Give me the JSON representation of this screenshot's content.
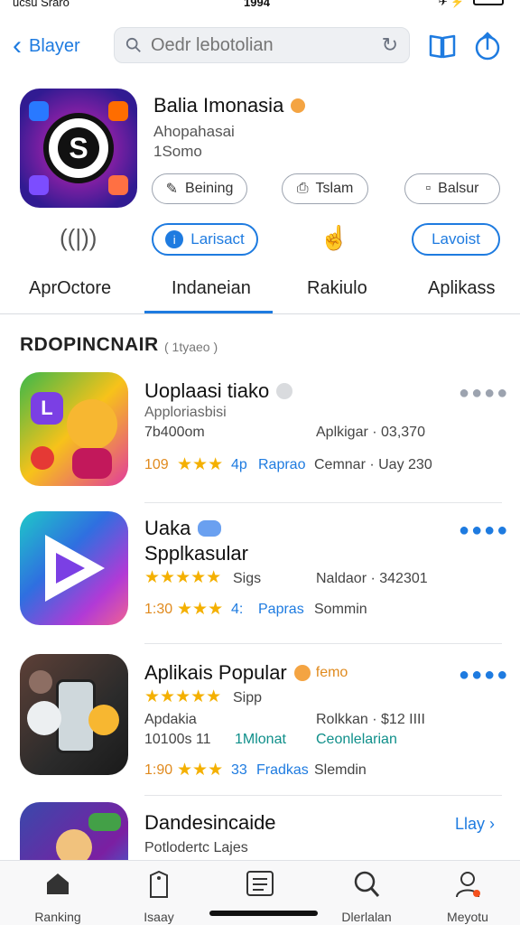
{
  "status_bar": {
    "carrier": "ucsu Sraro",
    "time": "1994"
  },
  "nav": {
    "back_label": "Blayer",
    "search_placeholder": "Oedr lebotolian"
  },
  "hero": {
    "title": "Balia Imonasia",
    "subtitle": "Ahopahasai",
    "subtitle2": "1Somo",
    "buttons": [
      {
        "label": "Beining",
        "icon": "chat-icon"
      },
      {
        "label": "Tslam",
        "icon": "bookmark-icon"
      },
      {
        "label": "Balsur",
        "icon": "square-icon"
      }
    ]
  },
  "actions": {
    "primary_label": "Larisact",
    "secondary_label": "Lavoist"
  },
  "tabs": [
    "AprOctore",
    "Indaneian",
    "Rakiulo",
    "Aplikass"
  ],
  "active_tab": 1,
  "section": {
    "title": "RDOPINCNAIR",
    "subtitle": "( 1tyaeo )"
  },
  "apps": [
    {
      "name": "Uoplaasi tiako",
      "line1": "Apploriasbisi",
      "line2": "7b400om",
      "info": "Aplkigar · 03,370",
      "score": "109",
      "stars": "★★★",
      "count": "4p",
      "tag": "Raprao",
      "extra": "Cemnar · Uay 230",
      "badge_color": "#d9dbde"
    },
    {
      "name": "Uaka",
      "line1": "Spplkasular",
      "line2": "Sigs",
      "info": "Naldaor · 342301",
      "score": "1:30",
      "stars": "★★★★★",
      "count": "4:",
      "tag": "Papras",
      "extra": "Sommin",
      "badge_color": "#6aa0f0"
    },
    {
      "name": "Aplikais Popular",
      "name_tag": "femo",
      "line1": "Sipp",
      "line2": "Apdakia",
      "line3": "10100s  11",
      "line3b": "1Mlonat",
      "info": "Rolkkan · $12 IIII",
      "info2": "Ceonlelarian",
      "score": "1:90",
      "stars": "★★★",
      "count": "33",
      "tag": "Fradkas",
      "extra": "Slemdin",
      "badge_color": "#f4a442"
    },
    {
      "name": "Dandesincaide",
      "line1": "Potlodertc  Lajes",
      "action": "Llay"
    }
  ],
  "tabbar": [
    {
      "label": "Ranking",
      "icon": "home-icon"
    },
    {
      "label": "Isaay",
      "icon": "tag-icon"
    },
    {
      "label": "",
      "icon": "list-icon"
    },
    {
      "label": "Dlerlalan",
      "icon": "search-icon"
    },
    {
      "label": "Meyotu",
      "icon": "person-icon"
    }
  ],
  "colors": {
    "accent": "#1e7be0",
    "star": "#f4b000",
    "score": "#e08a1e"
  }
}
